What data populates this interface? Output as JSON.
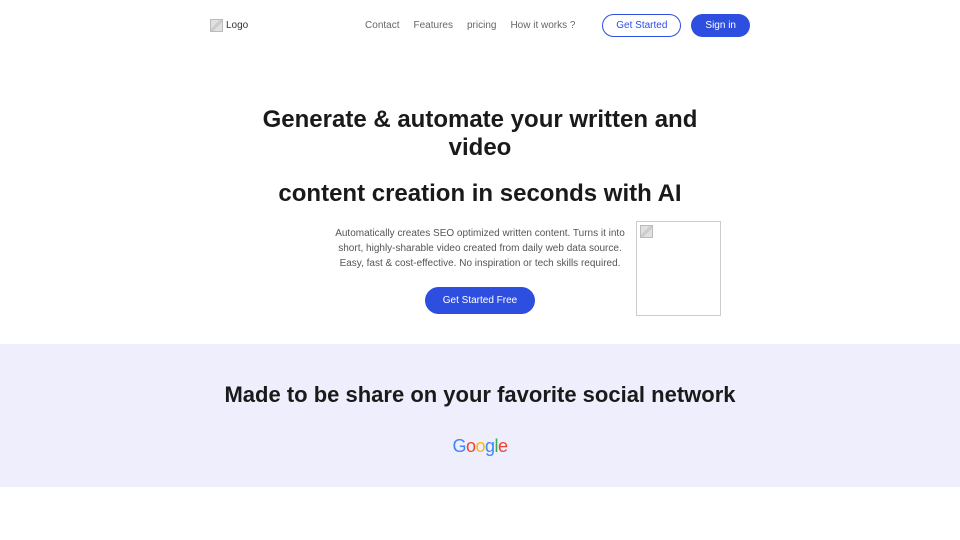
{
  "header": {
    "logo_alt": "Logo",
    "nav": [
      "Contact",
      "Features",
      "pricing",
      "How it works ?"
    ],
    "get_started": "Get Started",
    "sign_in": "Sign in"
  },
  "hero": {
    "title_line1": "Generate & automate your written and video",
    "title_line2": "content creation in seconds with AI",
    "subtitle": "Automatically creates SEO optimized written content. Turns it into short, highly-sharable video created from daily web data source. Easy, fast & cost-effective. No inspiration or tech skills required.",
    "cta": "Get Started Free"
  },
  "social": {
    "heading": "Made to be share on your favorite social network",
    "brand": "Google"
  }
}
